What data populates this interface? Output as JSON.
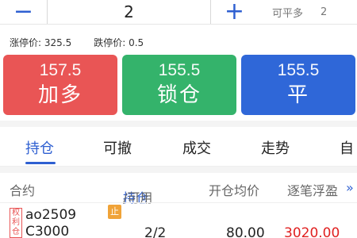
{
  "order": {
    "minus_symbol": "−",
    "quantity": "2",
    "plus_symbol": "+",
    "available_label": "可平多",
    "available_value": "2"
  },
  "limits": {
    "up_label": "涨停价:",
    "up_value": "325.5",
    "down_label": "跌停价:",
    "down_value": "0.5"
  },
  "actions": [
    {
      "price": "157.5",
      "label": "加多",
      "color": "#e95555"
    },
    {
      "price": "155.5",
      "label": "锁仓",
      "color": "#34b36b"
    },
    {
      "price": "155.5",
      "label": "平",
      "color": "#2f67d8"
    }
  ],
  "tabs": [
    {
      "label": "持仓",
      "active": true
    },
    {
      "label": "可撤",
      "active": false
    },
    {
      "label": "成交",
      "active": false
    },
    {
      "label": "走势",
      "active": false
    },
    {
      "label": "自",
      "active": false
    }
  ],
  "table": {
    "headers": {
      "contract": "合约",
      "position": "持仓",
      "available": "/可用",
      "avg_price": "开仓均价",
      "float_pnl": "逐笔浮盈"
    },
    "more_symbol": "»",
    "rows": [
      {
        "tag": "权利仓",
        "code_line1": "ao2509",
        "code_line2": "C3000",
        "stop_badge": "止",
        "position": "2/2",
        "avg_price": "80.00",
        "float_pnl": "3020.00"
      }
    ]
  }
}
